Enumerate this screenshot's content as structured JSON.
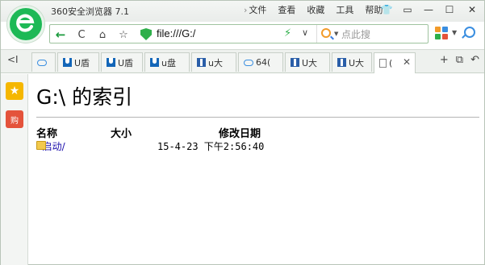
{
  "titlebar": {
    "app_title": "360安全浏览器 7.1",
    "menu_chevron": "›",
    "menus": [
      "文件",
      "查看",
      "收藏",
      "工具",
      "帮助"
    ],
    "window_buttons": {
      "shirt": "👕",
      "restore": "▭",
      "minimize": "—",
      "maximize": "☐",
      "close": "✕"
    }
  },
  "navbar": {
    "back": "←",
    "refresh": "C",
    "home": "⌂",
    "favorite": "☆",
    "url": "file:///G:/",
    "speed": "⚡",
    "dropdown": "∨",
    "search_placeholder": "点此搜",
    "search_dropdown": "▼",
    "apps_dropdown": "▼"
  },
  "tabs": {
    "nav_prev": "<I",
    "items": [
      {
        "icon": "cloud-icon",
        "label": ""
      },
      {
        "icon": "u-icon",
        "label": "U盾"
      },
      {
        "icon": "u-icon",
        "label": "U盾"
      },
      {
        "icon": "u-icon",
        "label": "u盘"
      },
      {
        "icon": "blue-page-icon",
        "label": "u大"
      },
      {
        "icon": "cloud-icon",
        "label": "64("
      },
      {
        "icon": "blue-page-icon",
        "label": "U大"
      },
      {
        "icon": "blue-page-icon",
        "label": "U大"
      },
      {
        "icon": "page-icon",
        "label": "("
      }
    ],
    "active_close": "✕",
    "new_tab": "+",
    "tab_list": "⧉",
    "undo": "↶"
  },
  "sidebar": {
    "favorites": "★",
    "shopping": "购"
  },
  "page": {
    "title": "G:\\ 的索引",
    "columns": {
      "name": "名称",
      "size": "大小",
      "modified": "修改日期"
    },
    "rows": [
      {
        "name": "u启动/",
        "size": "",
        "modified": "15-4-23 下午2:56:40"
      }
    ]
  },
  "colors": {
    "brand_green": "#1db956",
    "link": "#1a0dab",
    "favorites_yellow": "#f5b700",
    "shopping_red": "#e4533b"
  }
}
